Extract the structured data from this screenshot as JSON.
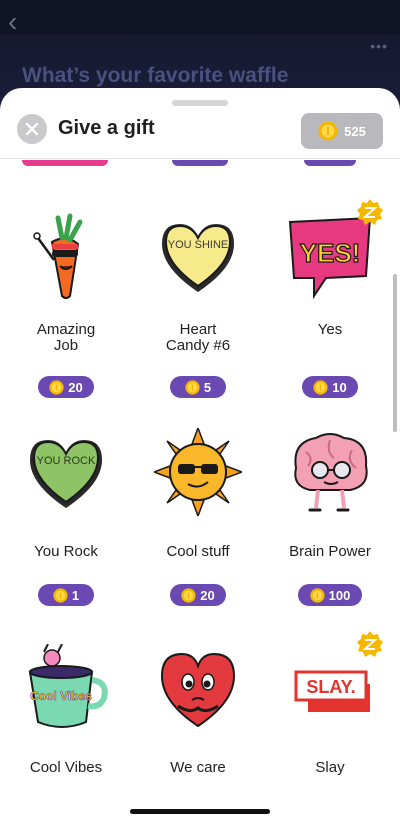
{
  "background": {
    "question": "What’s your favorite waffle",
    "more_label": "•••"
  },
  "sheet": {
    "title": "Give a gift",
    "coin_balance": "525"
  },
  "gifts": [
    {
      "name": "Amazing Job",
      "price": "20",
      "art": "carrot-icon",
      "badge": false
    },
    {
      "name": "Heart Candy #6",
      "price": "5",
      "art": "heart-candy-icon",
      "art_text": "YOU SHINE",
      "badge": false
    },
    {
      "name": "Yes",
      "price": "10",
      "art": "yes-bubble-icon",
      "art_text": "YES!",
      "badge": true
    },
    {
      "name": "You Rock",
      "price": "1",
      "art": "heart-candy-icon",
      "art_text": "YOU ROCK",
      "badge": false
    },
    {
      "name": "Cool stuff",
      "price": "20",
      "art": "sun-sunglasses-icon",
      "badge": false
    },
    {
      "name": "Brain Power",
      "price": "100",
      "art": "brain-icon",
      "badge": false
    },
    {
      "name": "Cool Vibes",
      "art": "mug-icon",
      "art_text": "Cool Vibes",
      "badge": false
    },
    {
      "name": "We care",
      "art": "heart-hug-icon",
      "badge": false
    },
    {
      "name": "Slay",
      "art": "slay-icon",
      "art_text": "SLAY.",
      "badge": true
    }
  ],
  "colors": {
    "price_pill": "#6a4ab2",
    "coin": "#f5b700",
    "badge": "#f5b700"
  }
}
